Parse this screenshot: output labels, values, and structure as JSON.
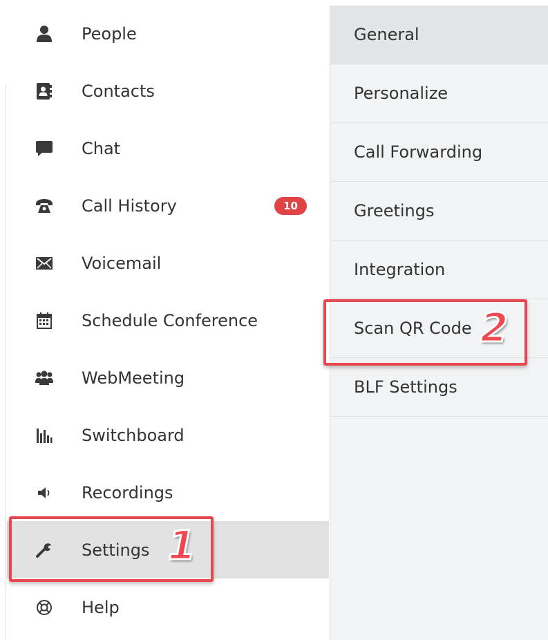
{
  "sidebar": {
    "items": [
      {
        "label": "People",
        "icon": "person-icon"
      },
      {
        "label": "Contacts",
        "icon": "contacts-book-icon"
      },
      {
        "label": "Chat",
        "icon": "chat-bubble-icon"
      },
      {
        "label": "Call History",
        "icon": "telephone-icon",
        "badge": "10"
      },
      {
        "label": "Voicemail",
        "icon": "envelope-icon"
      },
      {
        "label": "Schedule Conference",
        "icon": "calendar-icon"
      },
      {
        "label": "WebMeeting",
        "icon": "group-icon"
      },
      {
        "label": "Switchboard",
        "icon": "switchboard-bars-icon"
      },
      {
        "label": "Recordings",
        "icon": "speaker-icon"
      },
      {
        "label": "Settings",
        "icon": "wrench-icon",
        "active": true
      },
      {
        "label": "Help",
        "icon": "lifebuoy-icon"
      }
    ]
  },
  "settings_menu": {
    "items": [
      {
        "label": "General",
        "active": true
      },
      {
        "label": "Personalize"
      },
      {
        "label": "Call Forwarding"
      },
      {
        "label": "Greetings"
      },
      {
        "label": "Integration"
      },
      {
        "label": "Scan QR Code"
      },
      {
        "label": "BLF Settings"
      }
    ]
  },
  "annotations": {
    "step1": "1",
    "step2": "2",
    "highlight_color": "#e8474d"
  },
  "colors": {
    "badge": "#e04343",
    "active_row": "#e2e2e2",
    "panel_background": "#f1f3f4"
  }
}
